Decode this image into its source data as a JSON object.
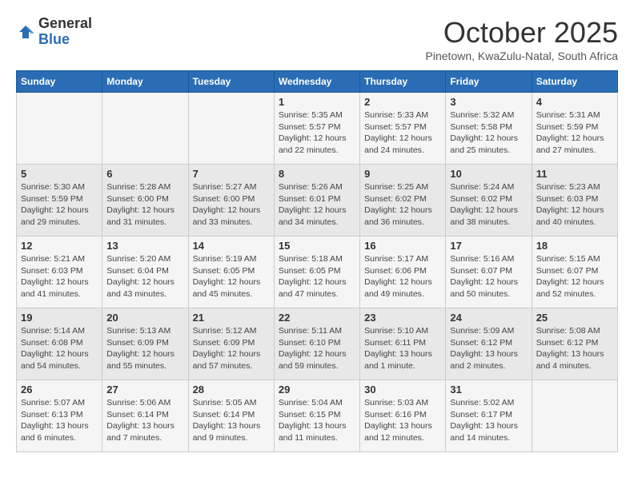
{
  "header": {
    "logo_general": "General",
    "logo_blue": "Blue",
    "month_title": "October 2025",
    "subtitle": "Pinetown, KwaZulu-Natal, South Africa"
  },
  "weekdays": [
    "Sunday",
    "Monday",
    "Tuesday",
    "Wednesday",
    "Thursday",
    "Friday",
    "Saturday"
  ],
  "weeks": [
    [
      {
        "day": "",
        "info": ""
      },
      {
        "day": "",
        "info": ""
      },
      {
        "day": "",
        "info": ""
      },
      {
        "day": "1",
        "info": "Sunrise: 5:35 AM\nSunset: 5:57 PM\nDaylight: 12 hours\nand 22 minutes."
      },
      {
        "day": "2",
        "info": "Sunrise: 5:33 AM\nSunset: 5:57 PM\nDaylight: 12 hours\nand 24 minutes."
      },
      {
        "day": "3",
        "info": "Sunrise: 5:32 AM\nSunset: 5:58 PM\nDaylight: 12 hours\nand 25 minutes."
      },
      {
        "day": "4",
        "info": "Sunrise: 5:31 AM\nSunset: 5:59 PM\nDaylight: 12 hours\nand 27 minutes."
      }
    ],
    [
      {
        "day": "5",
        "info": "Sunrise: 5:30 AM\nSunset: 5:59 PM\nDaylight: 12 hours\nand 29 minutes."
      },
      {
        "day": "6",
        "info": "Sunrise: 5:28 AM\nSunset: 6:00 PM\nDaylight: 12 hours\nand 31 minutes."
      },
      {
        "day": "7",
        "info": "Sunrise: 5:27 AM\nSunset: 6:00 PM\nDaylight: 12 hours\nand 33 minutes."
      },
      {
        "day": "8",
        "info": "Sunrise: 5:26 AM\nSunset: 6:01 PM\nDaylight: 12 hours\nand 34 minutes."
      },
      {
        "day": "9",
        "info": "Sunrise: 5:25 AM\nSunset: 6:02 PM\nDaylight: 12 hours\nand 36 minutes."
      },
      {
        "day": "10",
        "info": "Sunrise: 5:24 AM\nSunset: 6:02 PM\nDaylight: 12 hours\nand 38 minutes."
      },
      {
        "day": "11",
        "info": "Sunrise: 5:23 AM\nSunset: 6:03 PM\nDaylight: 12 hours\nand 40 minutes."
      }
    ],
    [
      {
        "day": "12",
        "info": "Sunrise: 5:21 AM\nSunset: 6:03 PM\nDaylight: 12 hours\nand 41 minutes."
      },
      {
        "day": "13",
        "info": "Sunrise: 5:20 AM\nSunset: 6:04 PM\nDaylight: 12 hours\nand 43 minutes."
      },
      {
        "day": "14",
        "info": "Sunrise: 5:19 AM\nSunset: 6:05 PM\nDaylight: 12 hours\nand 45 minutes."
      },
      {
        "day": "15",
        "info": "Sunrise: 5:18 AM\nSunset: 6:05 PM\nDaylight: 12 hours\nand 47 minutes."
      },
      {
        "day": "16",
        "info": "Sunrise: 5:17 AM\nSunset: 6:06 PM\nDaylight: 12 hours\nand 49 minutes."
      },
      {
        "day": "17",
        "info": "Sunrise: 5:16 AM\nSunset: 6:07 PM\nDaylight: 12 hours\nand 50 minutes."
      },
      {
        "day": "18",
        "info": "Sunrise: 5:15 AM\nSunset: 6:07 PM\nDaylight: 12 hours\nand 52 minutes."
      }
    ],
    [
      {
        "day": "19",
        "info": "Sunrise: 5:14 AM\nSunset: 6:08 PM\nDaylight: 12 hours\nand 54 minutes."
      },
      {
        "day": "20",
        "info": "Sunrise: 5:13 AM\nSunset: 6:09 PM\nDaylight: 12 hours\nand 55 minutes."
      },
      {
        "day": "21",
        "info": "Sunrise: 5:12 AM\nSunset: 6:09 PM\nDaylight: 12 hours\nand 57 minutes."
      },
      {
        "day": "22",
        "info": "Sunrise: 5:11 AM\nSunset: 6:10 PM\nDaylight: 12 hours\nand 59 minutes."
      },
      {
        "day": "23",
        "info": "Sunrise: 5:10 AM\nSunset: 6:11 PM\nDaylight: 13 hours\nand 1 minute."
      },
      {
        "day": "24",
        "info": "Sunrise: 5:09 AM\nSunset: 6:12 PM\nDaylight: 13 hours\nand 2 minutes."
      },
      {
        "day": "25",
        "info": "Sunrise: 5:08 AM\nSunset: 6:12 PM\nDaylight: 13 hours\nand 4 minutes."
      }
    ],
    [
      {
        "day": "26",
        "info": "Sunrise: 5:07 AM\nSunset: 6:13 PM\nDaylight: 13 hours\nand 6 minutes."
      },
      {
        "day": "27",
        "info": "Sunrise: 5:06 AM\nSunset: 6:14 PM\nDaylight: 13 hours\nand 7 minutes."
      },
      {
        "day": "28",
        "info": "Sunrise: 5:05 AM\nSunset: 6:14 PM\nDaylight: 13 hours\nand 9 minutes."
      },
      {
        "day": "29",
        "info": "Sunrise: 5:04 AM\nSunset: 6:15 PM\nDaylight: 13 hours\nand 11 minutes."
      },
      {
        "day": "30",
        "info": "Sunrise: 5:03 AM\nSunset: 6:16 PM\nDaylight: 13 hours\nand 12 minutes."
      },
      {
        "day": "31",
        "info": "Sunrise: 5:02 AM\nSunset: 6:17 PM\nDaylight: 13 hours\nand 14 minutes."
      },
      {
        "day": "",
        "info": ""
      }
    ]
  ]
}
